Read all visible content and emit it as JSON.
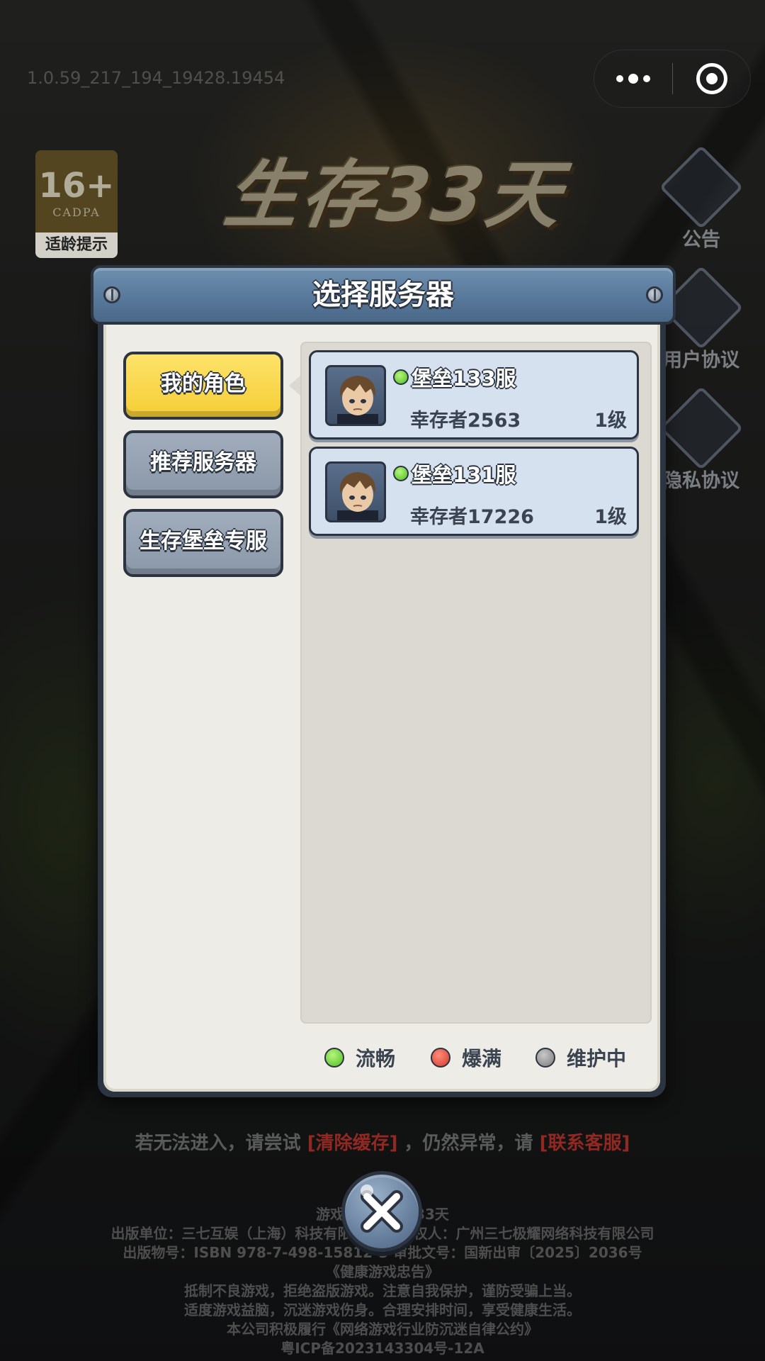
{
  "top": {
    "version": "1.0.59_217_194_19428.19454",
    "age_rating": {
      "number": "16+",
      "org": "CADPA",
      "tip": "适龄提示"
    },
    "logo_text": "生存33天"
  },
  "side_buttons": [
    {
      "label": "公告",
      "icon": "notice-icon"
    },
    {
      "label": "用户协议",
      "icon": "user-agreement-icon"
    },
    {
      "label": "隐私协议",
      "icon": "privacy-icon"
    }
  ],
  "dialog": {
    "title": "选择服务器",
    "tabs": [
      {
        "label": "我的角色",
        "active": true
      },
      {
        "label": "推荐服务器",
        "active": false
      },
      {
        "label": "生存堡垒专服",
        "active": false
      }
    ],
    "servers": [
      {
        "name": "堡垒133服",
        "player": "幸存者2563",
        "level": "1级",
        "status": "流畅"
      },
      {
        "name": "堡垒131服",
        "player": "幸存者17226",
        "level": "1级",
        "status": "流畅"
      }
    ],
    "legend": [
      {
        "label": "流畅",
        "color": "#4cbe23"
      },
      {
        "label": "爆满",
        "color": "#d33b2b"
      },
      {
        "label": "维护中",
        "color": "#7b7b7b"
      }
    ]
  },
  "hint": {
    "prefix": "若无法进入，请尝试",
    "clear_cache": "[清除缓存]",
    "middle": "，仍然异常，请",
    "contact": "[联系客服]"
  },
  "footer": {
    "lines": [
      "游戏名称：生存33天",
      "出版单位：三七互娱（上海）科技有限公司  著作权人：广州三七极耀网络科技有限公司",
      "出版物号：ISBN 978-7-498-15812-3  审批文号：国新出审〔2025〕2036号",
      "《健康游戏忠告》",
      "抵制不良游戏，拒绝盗版游戏。注意自我保护，谨防受骗上当。",
      "适度游戏益脑，沉迷游戏伤身。合理安排时间，享受健康生活。",
      "本公司积极履行《网络游戏行业防沉迷自律公约》",
      "粤ICP备2023143304号-12A"
    ]
  }
}
